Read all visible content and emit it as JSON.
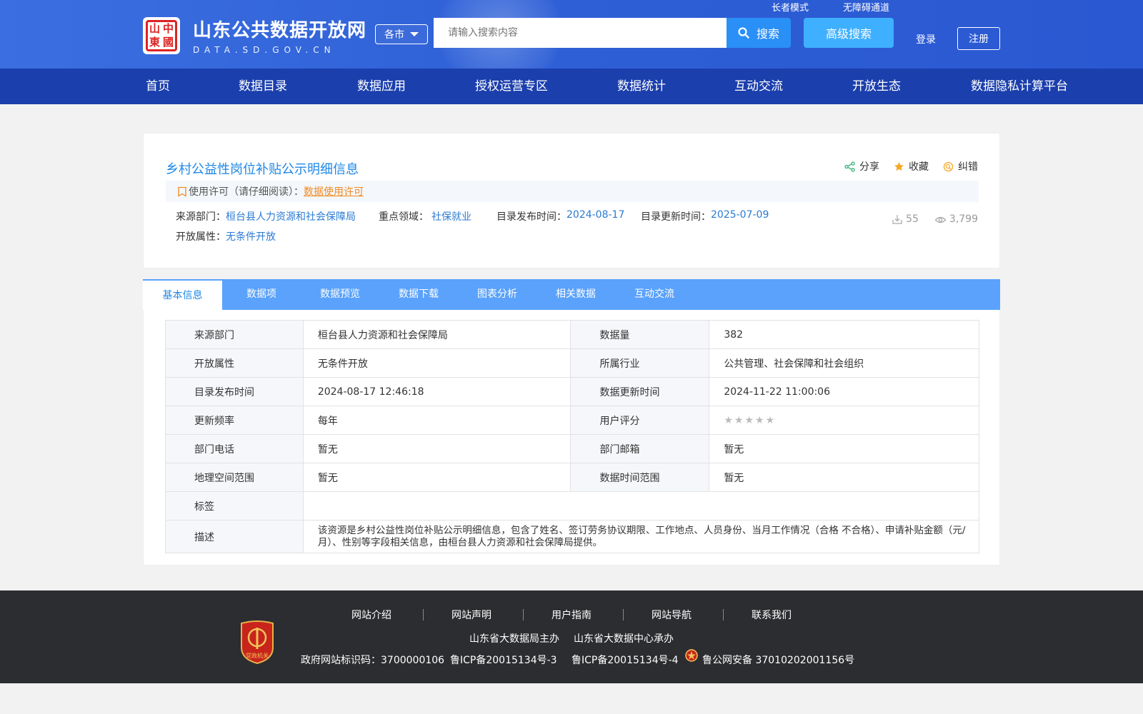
{
  "header": {
    "site_title": "山东公共数据开放网",
    "site_domain": "DATA.SD.GOV.CN",
    "seal_chars": [
      "山",
      "中",
      "東",
      "國"
    ],
    "city_select": "各市",
    "search_placeholder": "请输入搜索内容",
    "search_btn": "搜索",
    "advanced_btn": "高级搜索",
    "elder_mode": "长者模式",
    "accessibility": "无障碍通道",
    "login": "登录",
    "register": "注册"
  },
  "nav": [
    "首页",
    "数据目录",
    "数据应用",
    "授权运营专区",
    "数据统计",
    "互动交流",
    "开放生态",
    "数据隐私计算平台"
  ],
  "dataset": {
    "title": "乡村公益性岗位补贴公示明细信息",
    "actions": {
      "share": "分享",
      "favorite": "收藏",
      "report": "纠错"
    },
    "license_prefix": "使用许可（请仔细阅读）：",
    "license_link": "数据使用许可",
    "meta": {
      "source_label": "来源部门：",
      "source_value": "桓台县人力资源和社会保障局",
      "field_label": "重点领域：",
      "field_value": "社保就业",
      "publish_label": "目录发布时间：",
      "publish_value": "2024-08-17",
      "update_label": "目录更新时间：",
      "update_value": "2025-07-09",
      "open_label": "开放属性：",
      "open_value": "无条件开放"
    },
    "downloads": "55",
    "views": "3,799"
  },
  "tabs": [
    "基本信息",
    "数据项",
    "数据预览",
    "数据下载",
    "图表分析",
    "相关数据",
    "互动交流"
  ],
  "info": {
    "source_k": "来源部门",
    "source_v": "桓台县人力资源和社会保障局",
    "count_k": "数据量",
    "count_v": "382",
    "open_k": "开放属性",
    "open_v": "无条件开放",
    "industry_k": "所属行业",
    "industry_v": "公共管理、社会保障和社会组织",
    "pub_k": "目录发布时间",
    "pub_v": "2024-08-17 12:46:18",
    "upd_k": "数据更新时间",
    "upd_v": "2024-11-22 11:00:06",
    "freq_k": "更新频率",
    "freq_v": "每年",
    "rating_k": "用户评分",
    "rating_stars": 0,
    "phone_k": "部门电话",
    "phone_v": "暂无",
    "email_k": "部门邮箱",
    "email_v": "暂无",
    "geo_k": "地理空间范围",
    "geo_v": "暂无",
    "time_k": "数据时间范围",
    "time_v": "暂无",
    "tags_k": "标签",
    "tags_v": "",
    "desc_k": "描述",
    "desc_v": "该资源是乡村公益性岗位补贴公示明细信息，包含了姓名、签订劳务协议期限、工作地点、人员身份、当月工作情况（合格 不合格）、申请补贴金额（元/月）、性别等字段相关信息，由桓台县人力资源和社会保障局提供。"
  },
  "footer": {
    "links": [
      "网站介绍",
      "网站声明",
      "用户指南",
      "网站导航",
      "联系我们"
    ],
    "host": "山东省大数据局主办",
    "organizer": "山东省大数据中心承办",
    "gov_id": "政府网站标识码：3700000106",
    "icp1": "鲁ICP备20015134号-3",
    "icp2": "鲁ICP备20015134号-4",
    "police": "鲁公网安备 37010202001156号",
    "badge_text": "党政机关"
  }
}
